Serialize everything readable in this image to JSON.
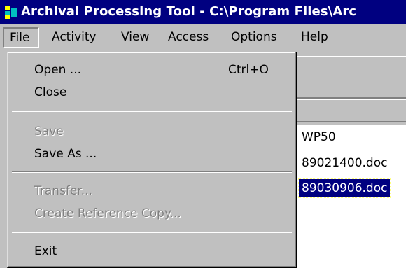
{
  "window": {
    "title": "Archival Processing Tool - C:\\Program Files\\Arc"
  },
  "menubar": {
    "items": [
      "File",
      "Activity",
      "View",
      "Access",
      "Options",
      "Help"
    ]
  },
  "file_menu": {
    "open_label": "Open ...",
    "open_shortcut": "Ctrl+O",
    "close_label": "Close",
    "save_label": "Save",
    "save_as_label": "Save As ...",
    "transfer_label": "Transfer...",
    "create_reference_copy_label": "Create Reference Copy...",
    "exit_label": "Exit"
  },
  "file_list": {
    "items": [
      {
        "name": "WP50",
        "selected": false
      },
      {
        "name": "89021400.doc",
        "selected": false
      },
      {
        "name": "89030906.doc",
        "selected": true
      }
    ]
  },
  "colors": {
    "titlebar": "#000080",
    "face": "#c0c0c0",
    "selection": "#000080",
    "disabled_text": "#808080"
  }
}
